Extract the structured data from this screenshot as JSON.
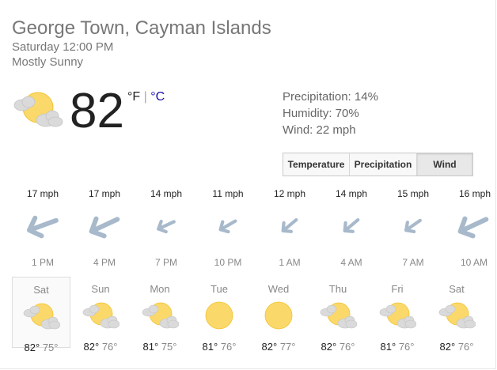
{
  "location": "George Town, Cayman Islands",
  "datetime": "Saturday 12:00 PM",
  "condition": "Mostly Sunny",
  "current": {
    "temp": "82",
    "unit_f": "°F",
    "unit_sep": "|",
    "unit_c": "°C"
  },
  "stats": {
    "precipitation": "Precipitation: 14%",
    "humidity": "Humidity: 70%",
    "wind": "Wind: 22 mph"
  },
  "tabs": [
    {
      "label": "Temperature"
    },
    {
      "label": "Precipitation"
    },
    {
      "label": "Wind",
      "active": true
    }
  ],
  "wind_hours": [
    {
      "speed": "17 mph",
      "time": "1 PM"
    },
    {
      "speed": "17 mph",
      "time": "4 PM"
    },
    {
      "speed": "14 mph",
      "time": "7 PM"
    },
    {
      "speed": "11 mph",
      "time": "10 PM"
    },
    {
      "speed": "12 mph",
      "time": "1 AM"
    },
    {
      "speed": "14 mph",
      "time": "4 AM"
    },
    {
      "speed": "15 mph",
      "time": "7 AM"
    },
    {
      "speed": "16 mph",
      "time": "10 AM"
    }
  ],
  "days": [
    {
      "name": "Sat",
      "hi": "82°",
      "lo": "75°",
      "icon": "partly-cloudy-icon"
    },
    {
      "name": "Sun",
      "hi": "82°",
      "lo": "76°",
      "icon": "partly-cloudy-icon"
    },
    {
      "name": "Mon",
      "hi": "81°",
      "lo": "75°",
      "icon": "partly-cloudy-icon"
    },
    {
      "name": "Tue",
      "hi": "81°",
      "lo": "76°",
      "icon": "sun-icon"
    },
    {
      "name": "Wed",
      "hi": "82°",
      "lo": "77°",
      "icon": "sun-icon"
    },
    {
      "name": "Thu",
      "hi": "82°",
      "lo": "76°",
      "icon": "partly-cloudy-icon"
    },
    {
      "name": "Fri",
      "hi": "81°",
      "lo": "76°",
      "icon": "partly-cloudy-icon"
    },
    {
      "name": "Sat",
      "hi": "82°",
      "lo": "76°",
      "icon": "partly-cloudy-icon"
    }
  ],
  "colors": {
    "sun": "#fbd86a",
    "sun_stroke": "#f1c232",
    "cloud": "#dadada",
    "arrow": "#a7b9ca",
    "link": "#1a0dab"
  }
}
